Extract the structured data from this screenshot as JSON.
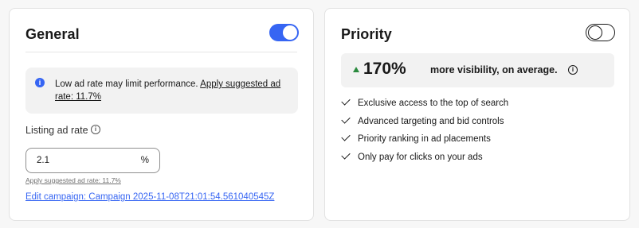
{
  "general": {
    "title": "General",
    "toggle_state": "on",
    "notice": {
      "text": "Low ad rate may limit performance. ",
      "link": "Apply suggested ad rate: 11.7%"
    },
    "listing_ad_rate": {
      "label": "Listing ad rate",
      "value": "2.1",
      "unit": "%"
    },
    "apply_suggested_small": "Apply suggested ad rate: 11.7%",
    "edit_campaign_link": "Edit campaign: Campaign 2025-11-08T21:01:54.561040545Z"
  },
  "priority": {
    "title": "Priority",
    "toggle_state": "off",
    "highlight": {
      "percent": "170%",
      "text": "more visibility, on average."
    },
    "benefits": [
      "Exclusive access to the top of search",
      "Advanced targeting and bid controls",
      "Priority ranking in ad placements",
      "Only pay for clicks on your ads"
    ]
  },
  "colors": {
    "accent": "#3665f3",
    "up_arrow": "#2a8a3e"
  },
  "icons": [
    "info-icon",
    "check-icon",
    "up-arrow-icon",
    "toggle-switch"
  ]
}
